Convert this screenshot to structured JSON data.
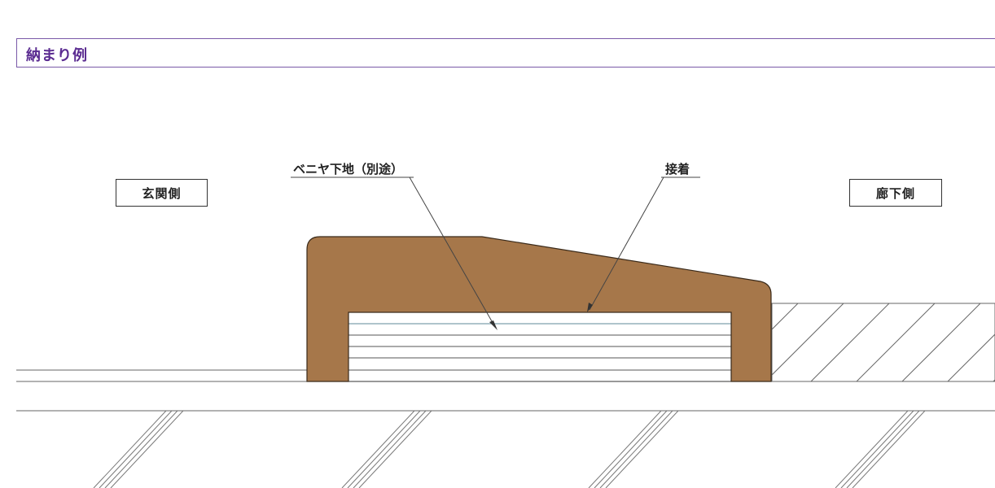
{
  "section": {
    "title": "納まり例"
  },
  "sides": {
    "left": "玄関側",
    "right": "廊下側"
  },
  "callouts": {
    "veneer": "ベニヤ下地（別途）",
    "adhesive": "接着"
  },
  "colors": {
    "threshold": "#a6774a",
    "threshold_stroke": "#3a2a1a",
    "header_border": "#7a5aa8",
    "header_text": "#5b2c91",
    "line": "#555555",
    "veneer_line": "#5f8a9a"
  }
}
